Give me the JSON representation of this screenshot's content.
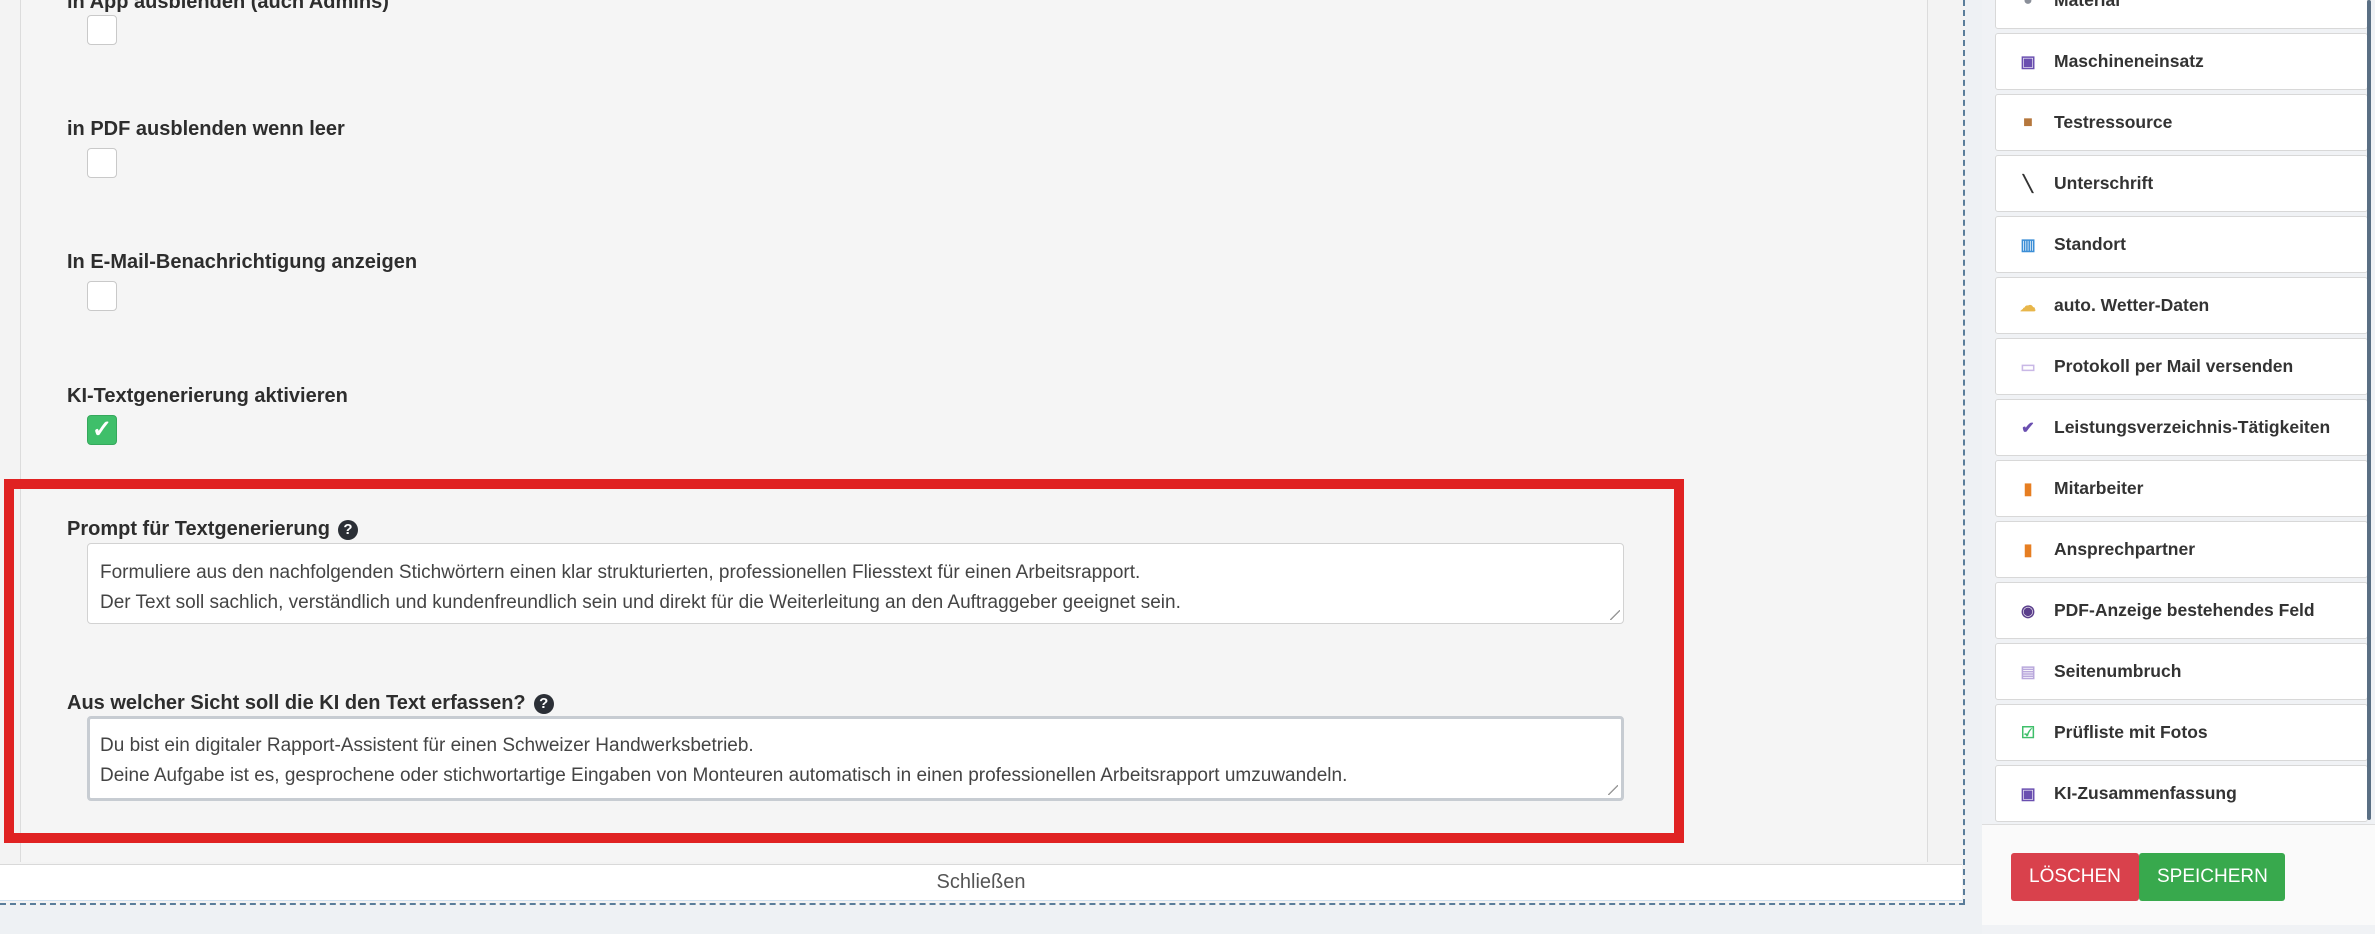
{
  "form": {
    "fields": [
      {
        "label": "in App ausblenden (auch Admins)",
        "checked": false
      },
      {
        "label": "in PDF ausblenden wenn leer",
        "checked": false
      },
      {
        "label": "In E-Mail-Benachrichtigung anzeigen",
        "checked": false
      },
      {
        "label": "KI-Textgenerierung aktivieren",
        "checked": true
      }
    ],
    "prompt": {
      "label": "Prompt für Textgenerierung",
      "line1": "Formuliere aus den nachfolgenden Stichwörtern einen klar strukturierten, professionellen Fliesstext für einen Arbeitsrapport.",
      "line2": "Der Text soll sachlich, verständlich und kundenfreundlich sein und direkt für die Weiterleitung an den Auftraggeber geeignet sein."
    },
    "perspective": {
      "label": "Aus welcher Sicht soll die KI den Text erfassen?",
      "line1": "Du bist ein digitaler Rapport-Assistent für einen Schweizer Handwerksbetrieb.",
      "line2": "Deine Aufgabe ist es, gesprochene oder stichwortartige Eingaben von Monteuren automatisch in einen professionellen Arbeitsrapport umzuwandeln."
    },
    "help_glyph": "?",
    "check_glyph": "✓",
    "close_label": "Schließen"
  },
  "sidebar": {
    "items": [
      {
        "label": "Material",
        "icon": "material-icon"
      },
      {
        "label": "Maschineneinsatz",
        "icon": "robot-icon"
      },
      {
        "label": "Testressource",
        "icon": "box-icon"
      },
      {
        "label": "Unterschrift",
        "icon": "pen-icon"
      },
      {
        "label": "Standort",
        "icon": "map-icon"
      },
      {
        "label": "auto. Wetter-Daten",
        "icon": "weather-icon"
      },
      {
        "label": "Protokoll per Mail versenden",
        "icon": "envelope-icon"
      },
      {
        "label": "Leistungsverzeichnis-Tätigkeiten",
        "icon": "checkmark-icon"
      },
      {
        "label": "Mitarbeiter",
        "icon": "person-icon"
      },
      {
        "label": "Ansprechpartner",
        "icon": "person-icon"
      },
      {
        "label": "PDF-Anzeige bestehendes Feld",
        "icon": "eye-icon"
      },
      {
        "label": "Seitenumbruch",
        "icon": "page-icon"
      },
      {
        "label": "Prüfliste mit Fotos",
        "icon": "checkbox-icon"
      },
      {
        "label": "KI-Zusammenfassung",
        "icon": "robot-icon"
      }
    ],
    "delete_label": "LÖSCHEN",
    "save_label": "SPEICHERN"
  },
  "colors": {
    "highlight": "#e02222",
    "delete": "#d9414c",
    "save": "#38a94d",
    "checked": "#3fbf6a"
  }
}
